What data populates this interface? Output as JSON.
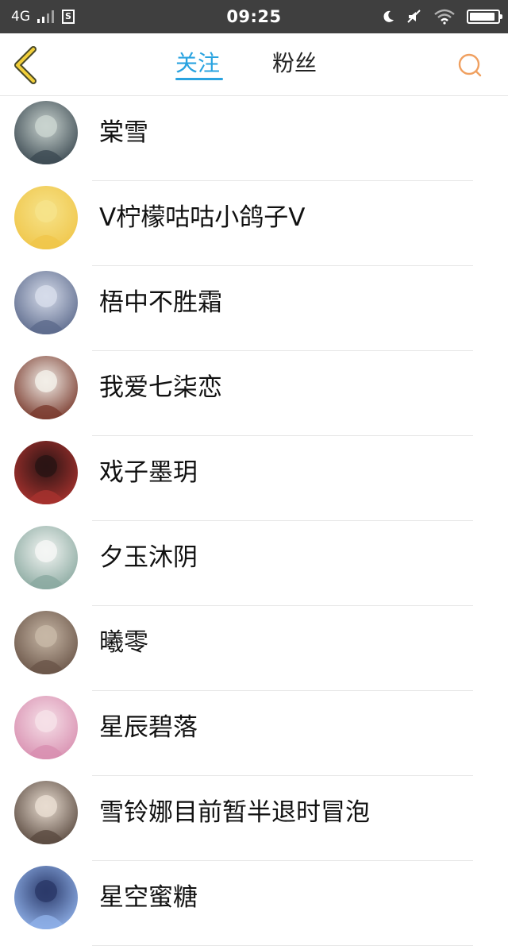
{
  "status_bar": {
    "network": "4G",
    "time": "09:25",
    "battery_level": 0.9
  },
  "nav": {
    "tabs": [
      {
        "label": "关注",
        "active": true
      },
      {
        "label": "粉丝",
        "active": false
      }
    ],
    "accent_color": "#29a3e0",
    "back_icon": "chevron-left-icon",
    "search_icon": "search-icon"
  },
  "users": [
    {
      "name": "棠雪",
      "avatar_colors": [
        "#c9d3cf",
        "#3c4a52"
      ]
    },
    {
      "name": "V柠檬咕咕小鸽子V",
      "avatar_colors": [
        "#f6e38a",
        "#f0c64a"
      ]
    },
    {
      "name": "梧中不胜霜",
      "avatar_colors": [
        "#d6dcea",
        "#5c6a8c"
      ]
    },
    {
      "name": "我爱七柒恋",
      "avatar_colors": [
        "#f2eee8",
        "#7a3b2e"
      ]
    },
    {
      "name": "戏子墨玥",
      "avatar_colors": [
        "#2a1414",
        "#a8322e"
      ]
    },
    {
      "name": "夕玉沐阴",
      "avatar_colors": [
        "#f4f6f4",
        "#8aa9a0"
      ]
    },
    {
      "name": "曦零",
      "avatar_colors": [
        "#c7b7a6",
        "#6a5548"
      ]
    },
    {
      "name": "星辰碧落",
      "avatar_colors": [
        "#f6e0e8",
        "#d88fb0"
      ]
    },
    {
      "name": "雪铃娜目前暂半退时冒泡",
      "avatar_colors": [
        "#e8dcd0",
        "#5a4a40"
      ]
    },
    {
      "name": "星空蜜糖",
      "avatar_colors": [
        "#2b3a6a",
        "#8fb0e8"
      ]
    }
  ]
}
